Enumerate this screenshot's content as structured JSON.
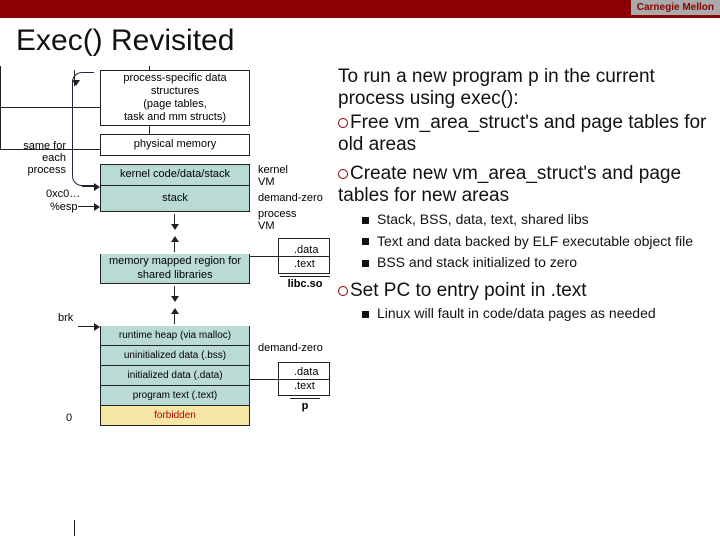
{
  "header": {
    "brand": "Carnegie Mellon",
    "title": "Exec() Revisited"
  },
  "diagram": {
    "process_specific": "process-specific data\nstructures\n(page tables,\ntask and mm structs)",
    "physical": "physical memory",
    "kernel": "kernel code/data/stack",
    "stack": "stack",
    "mmap": "memory mapped region for\nshared libraries",
    "heap": "runtime heap (via malloc)",
    "bss": "uninitialized data (.bss)",
    "data": "initialized data (.data)",
    "text": "program text (.text)",
    "forbidden": "forbidden"
  },
  "labels": {
    "same_for_each": "same for\neach\nprocess",
    "c0": "0xc0…",
    "esp": "%esp",
    "brk": "brk",
    "zero": "0",
    "kernel_vm": "kernel\nVM",
    "demand_zero": "demand-zero",
    "process_vm": "process\nVM",
    "lib_data": ".data",
    "lib_text": ".text",
    "libc": "libc.so",
    "demand_zero2": "demand-zero",
    "p_data": ".data",
    "p_text": ".text",
    "p": "p"
  },
  "bullets": {
    "lead": "To run a new program p in the current process using exec():",
    "b1": "Free vm_area_struct's and page tables for old areas",
    "b2": "Create new vm_area_struct's and page tables for new areas",
    "b2_subs": [
      "Stack, BSS, data, text, shared libs",
      "Text and data backed by ELF executable object file",
      "BSS and stack initialized to zero"
    ],
    "b3": "Set PC to entry point in .text",
    "b3_subs": [
      "Linux will fault in code/data pages as needed"
    ]
  }
}
